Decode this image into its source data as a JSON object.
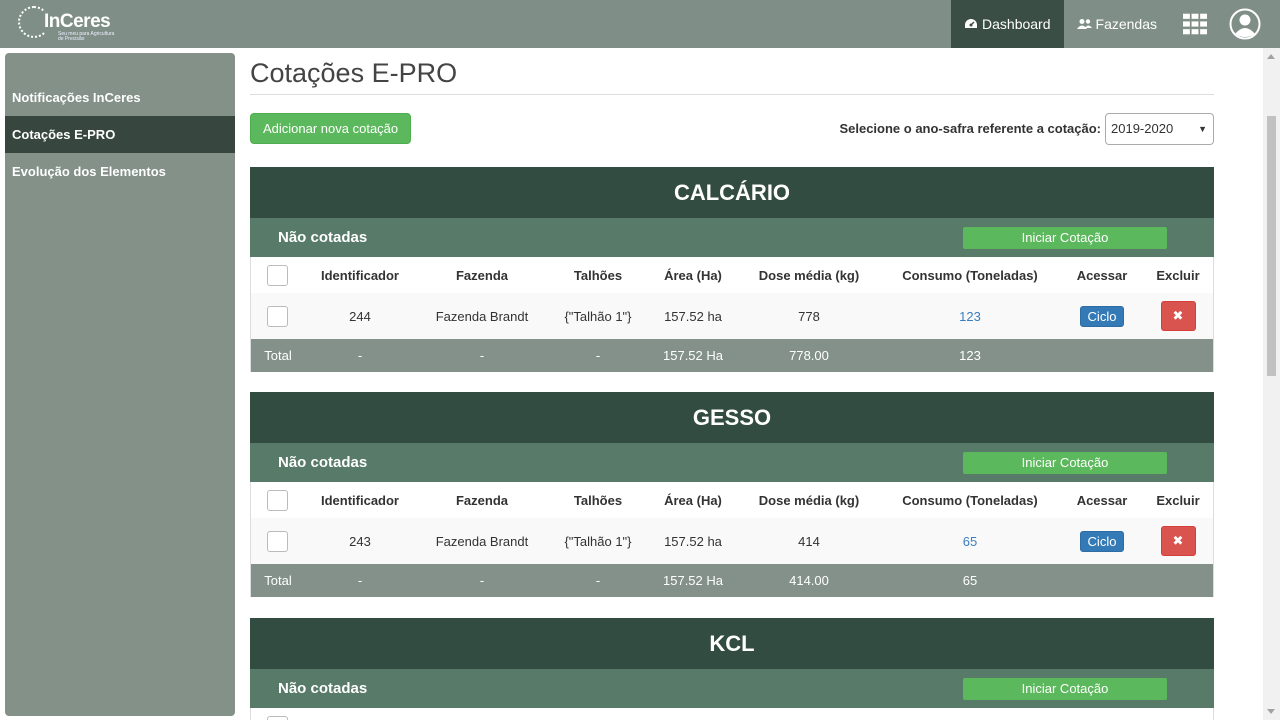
{
  "navbar": {
    "logo_text": "InCeres",
    "logo_tagline": "Seu meu para Agricultura de Precisão",
    "dashboard_label": "Dashboard",
    "fazendas_label": "Fazendas"
  },
  "sidebar": {
    "items": [
      {
        "label": "Notificações InCeres"
      },
      {
        "label": "Cotações E-PRO"
      },
      {
        "label": "Evolução dos Elementos"
      }
    ]
  },
  "page": {
    "title": "Cotações E-PRO",
    "add_button": "Adicionar nova cotação",
    "year_label": "Selecione o ano-safra referente a cotação:",
    "year_selected": "2019-2020"
  },
  "table_headers": {
    "identificador": "Identificador",
    "fazenda": "Fazenda",
    "talhoes": "Talhões",
    "area": "Área (Ha)",
    "dose": "Dose média (kg)",
    "consumo": "Consumo (Toneladas)",
    "acessar": "Acessar",
    "excluir": "Excluir"
  },
  "sections": [
    {
      "title": "CALCÁRIO",
      "sub_label": "Não cotadas",
      "start_button": "Iniciar Cotação",
      "row": {
        "id": "244",
        "fazenda": "Fazenda Brandt",
        "talhoes": "{\"Talhão 1\"}",
        "area": "157.52 ha",
        "dose": "778",
        "consumo": "123",
        "acessar": "Ciclo",
        "excluir": "✖"
      },
      "total": {
        "label": "Total",
        "id": "-",
        "fazenda": "-",
        "talhoes": "-",
        "area": "157.52 Ha",
        "dose": "778.00",
        "consumo": "123"
      }
    },
    {
      "title": "GESSO",
      "sub_label": "Não cotadas",
      "start_button": "Iniciar Cotação",
      "row": {
        "id": "243",
        "fazenda": "Fazenda Brandt",
        "talhoes": "{\"Talhão 1\"}",
        "area": "157.52 ha",
        "dose": "414",
        "consumo": "65",
        "acessar": "Ciclo",
        "excluir": "✖"
      },
      "total": {
        "label": "Total",
        "id": "-",
        "fazenda": "-",
        "talhoes": "-",
        "area": "157.52 Ha",
        "dose": "414.00",
        "consumo": "65"
      }
    },
    {
      "title": "KCL",
      "sub_label": "Não cotadas",
      "start_button": "Iniciar Cotação"
    }
  ]
}
